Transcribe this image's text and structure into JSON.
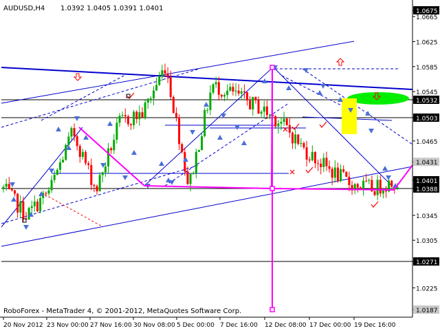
{
  "header": {
    "symbol_tf": "AUDUSD,H4",
    "ohlc": "1.0392 1.0405 1.0391 1.0401"
  },
  "footer": {
    "copyright": "RoboForex - MetaTrader 4, © 2001-2012, MetaQuotes Software Corp."
  },
  "colors": {
    "bull": "#00aa00",
    "bear": "#ff0000",
    "trendline": "#0000cc",
    "forecast": "#ff00ff",
    "level": "#000000",
    "target_zone": "#00ee00",
    "pullback_zone": "#ffff00",
    "icon": "#4a6fd8",
    "mark": "#ff0000"
  },
  "chart_data": {
    "type": "candlestick",
    "symbol": "AUDUSD",
    "timeframe": "H4",
    "ylim": [
      1.0165,
      1.0685
    ],
    "y_ticks": [
      "1.0675",
      "1.0665",
      "1.0625",
      "1.0585",
      "1.0545",
      "1.0532",
      "1.0503",
      "1.0465",
      "1.0431",
      "1.0401",
      "1.0388",
      "1.0345",
      "1.0305",
      "1.0271",
      "1.0225",
      "1.0187"
    ],
    "highlighted_levels": [
      {
        "label": "1.0675",
        "value": 1.0675,
        "style": "dark"
      },
      {
        "label": "1.0532",
        "value": 1.0532,
        "style": "line"
      },
      {
        "label": "1.0503",
        "value": 1.0503,
        "style": "line"
      },
      {
        "label": "1.0431",
        "value": 1.0431,
        "style": "dim"
      },
      {
        "label": "1.0401",
        "value": 1.0401,
        "style": "dark"
      },
      {
        "label": "1.0388",
        "value": 1.0388,
        "style": "line"
      },
      {
        "label": "1.0271",
        "value": 1.0271,
        "style": "line"
      },
      {
        "label": "1.0187",
        "value": 1.0187,
        "style": "dim"
      }
    ],
    "x_ticks": [
      "20 Nov 2012",
      "23 Nov 00:00",
      "27 Nov 16:00",
      "30 Nov 08:00",
      "5 Dec 00:00",
      "7 Dec 16:00",
      "12 Dec 08:00",
      "17 Dec 00:00",
      "19 Dec 16:00"
    ],
    "key_prices": [
      1.0388,
      1.0345,
      1.0385,
      1.0481,
      1.0385,
      1.0495,
      1.051,
      1.0588,
      1.039,
      1.0555,
      1.054,
      1.052,
      1.0495,
      1.045,
      1.042,
      1.0395,
      1.0388,
      1.0401
    ],
    "forecast_path": [
      1.0481,
      1.0385,
      1.0388,
      1.0588,
      1.0187,
      1.0388,
      1.0431
    ]
  }
}
